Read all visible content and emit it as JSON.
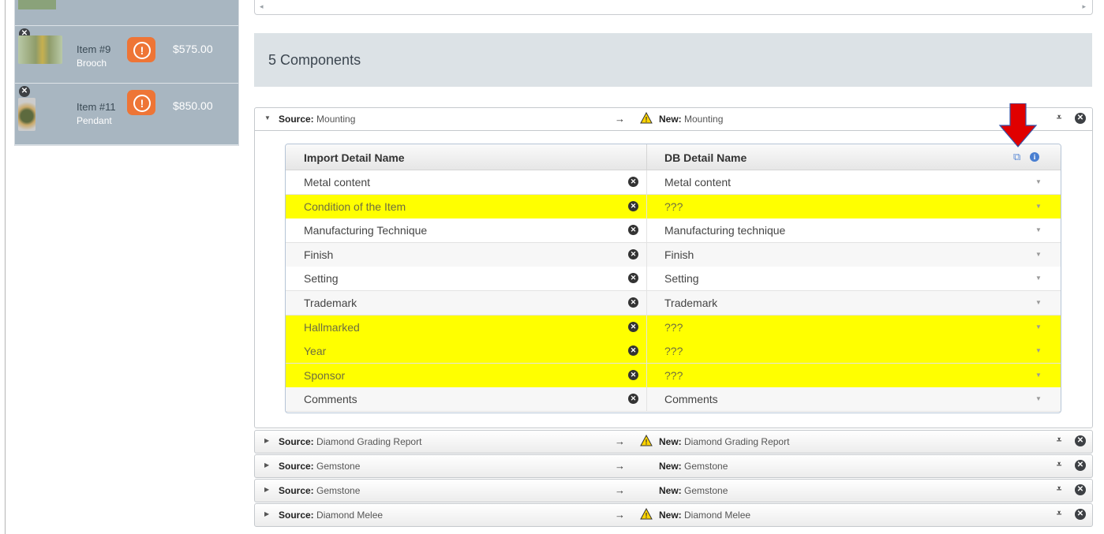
{
  "sidebar": {
    "items": [
      {
        "name": "Item #9",
        "sub": "Brooch",
        "price": "$575.00",
        "alert": "!"
      },
      {
        "name": "Item #11",
        "sub": "Pendant",
        "price": "$850.00",
        "alert": "!"
      }
    ]
  },
  "components": {
    "title": "5 Components"
  },
  "expanded": {
    "source_label": "Source:",
    "source_value": "Mounting",
    "arrow": "→",
    "new_label": "New:",
    "new_value": "Mounting",
    "table": {
      "col1": "Import Detail Name",
      "col2": "DB Detail Name",
      "rows": [
        {
          "import": "Metal content",
          "db": "Metal content"
        },
        {
          "import": "Condition of the Item",
          "db": "???"
        },
        {
          "import": "Manufacturing Technique",
          "db": "Manufacturing technique"
        },
        {
          "import": "Finish",
          "db": "Finish"
        },
        {
          "import": "Setting",
          "db": "Setting"
        },
        {
          "import": "Trademark",
          "db": "Trademark"
        },
        {
          "import": "Hallmarked",
          "db": "???"
        },
        {
          "import": "Year",
          "db": "???"
        },
        {
          "import": "Sponsor",
          "db": "???"
        },
        {
          "import": "Comments",
          "db": "Comments"
        }
      ]
    }
  },
  "collapsed_rows": [
    {
      "source_label": "Source:",
      "source_value": "Diamond Grading Report",
      "arrow": "→",
      "new_label": "New:",
      "new_value": "Diamond Grading Report",
      "warning": true
    },
    {
      "source_label": "Source:",
      "source_value": "Gemstone",
      "arrow": "→",
      "new_label": "New:",
      "new_value": "Gemstone",
      "warning": false
    },
    {
      "source_label": "Source:",
      "source_value": "Gemstone",
      "arrow": "→",
      "new_label": "New:",
      "new_value": "Gemstone",
      "warning": false
    },
    {
      "source_label": "Source:",
      "source_value": "Diamond Melee",
      "arrow": "→",
      "new_label": "New:",
      "new_value": "Diamond Melee",
      "warning": true
    }
  ],
  "colors": {
    "highlight": "#ffff00",
    "alert": "#ee7536",
    "annotation": "#e00000",
    "sidebar_item": "#a8b6c1"
  },
  "icons": {
    "remove": "close-circle-icon",
    "alert": "exclamation-circle-icon",
    "warning": "warning-triangle-icon",
    "copy": "copy-icon",
    "info": "info-icon",
    "collapse": "double-chevron-icon",
    "dropdown": "caret-down-icon"
  }
}
